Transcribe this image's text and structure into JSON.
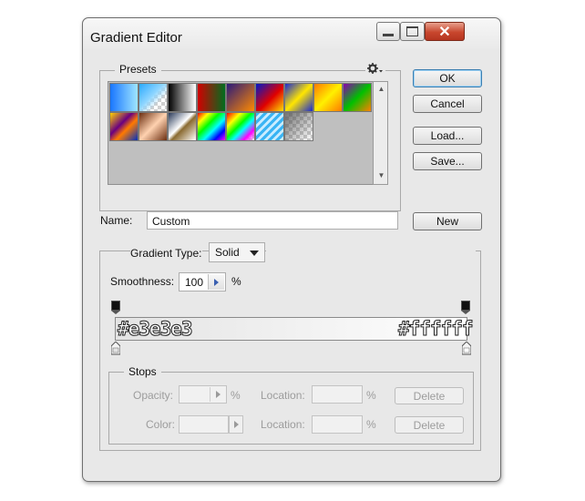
{
  "window": {
    "title": "Gradient Editor",
    "controls": {
      "minimize": "–",
      "maximize": "□",
      "close": "✕"
    }
  },
  "presets": {
    "legend": "Presets",
    "menu_icon": "gear-icon",
    "swatches": [
      {
        "id": "blue-cyan",
        "css": "linear-gradient(to right,#1976ff,#9fe6ff)"
      },
      {
        "id": "cyan-transparent",
        "css": "linear-gradient(135deg,#2aa9ff 0%,#8fd6ff 45%,rgba(255,255,255,0) 70%)"
      },
      {
        "id": "black-white",
        "css": "linear-gradient(to right,#000,#fff)"
      },
      {
        "id": "red-green",
        "css": "linear-gradient(to right,#d10000,#006d1f)"
      },
      {
        "id": "violet-orange",
        "css": "linear-gradient(135deg,#2b1a7a,#ff8a00)"
      },
      {
        "id": "blue-red-yellow",
        "css": "linear-gradient(135deg,#0018c9,#e00000 55%,#ffe000)"
      },
      {
        "id": "blue-yellow-blue",
        "css": "linear-gradient(135deg,#1b2bd0,#ffe600 50%,#1b2bd0)"
      },
      {
        "id": "orange-yellow-orange",
        "css": "linear-gradient(135deg,#ff7a00,#fff000 50%,#ff7a00)"
      },
      {
        "id": "violet-green-orange",
        "css": "linear-gradient(135deg,#8a00b0,#00c000 50%,#ff8000)"
      },
      {
        "id": "yellow-violet-orange-blue",
        "css": "linear-gradient(135deg,#ffd400,#6a0080 40%,#ff7a00 60%,#0030c0)"
      },
      {
        "id": "copper",
        "css": "linear-gradient(135deg,#6b2e10,#ffd2b0 50%,#6b2e10)"
      },
      {
        "id": "chrome",
        "css": "linear-gradient(135deg,#2a3a5a,#ffffff 45%,#8a6a30 55%,#ffffff)"
      },
      {
        "id": "spectrum",
        "css": "linear-gradient(135deg,#ff0000,#ffff00 20%,#00ff00 40%,#00ffff 60%,#0000ff 80%,#ff00ff)"
      },
      {
        "id": "transparent-rainbow",
        "css": "linear-gradient(135deg,#ff0000,#ffff00 25%,#00ff00 45%,#00ffff 60%,#ff00ff 80%,rgba(255,255,255,0))"
      },
      {
        "id": "transparent-stripes",
        "css": "repeating-linear-gradient(135deg,#39b4f4 0 3px,#c9ecff 3px 6px)"
      },
      {
        "id": "neutral-density",
        "css": "linear-gradient(135deg,rgba(80,80,80,0.8),rgba(255,255,255,0))"
      }
    ]
  },
  "buttons": {
    "ok": "OK",
    "cancel": "Cancel",
    "load": "Load...",
    "save": "Save...",
    "new": "New"
  },
  "name_field": {
    "label": "Name:",
    "value": "Custom"
  },
  "gradient_type": {
    "label": "Gradient Type:",
    "value": "Solid"
  },
  "smoothness": {
    "label": "Smoothness:",
    "value": "100",
    "unit": "%"
  },
  "gradient_bar": {
    "start_color": "#e3e3e3",
    "end_color": "#ffffff",
    "start_label": "#e3e3e3",
    "end_label": "#ffffff"
  },
  "stops": {
    "legend": "Stops",
    "opacity_label": "Opacity:",
    "opacity_unit": "%",
    "opacity_location_label": "Location:",
    "opacity_location_unit": "%",
    "color_label": "Color:",
    "color_location_label": "Location:",
    "color_location_unit": "%",
    "delete_label": "Delete"
  }
}
